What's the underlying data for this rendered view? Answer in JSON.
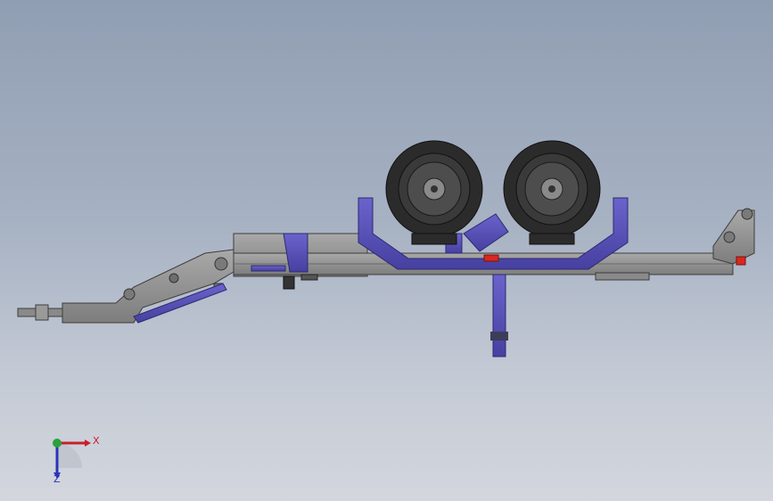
{
  "triad": {
    "x_label": "X",
    "z_label": "Z",
    "x_color": "#c8202a",
    "z_color": "#2a34b8",
    "origin_color": "#27a33a"
  },
  "colors": {
    "frame_gray": "#8e8e8e",
    "frame_dark": "#5a5a5a",
    "accent_blue": "#5a52b8",
    "tire_black": "#2b2b2b",
    "reflector_red": "#d8281e"
  }
}
